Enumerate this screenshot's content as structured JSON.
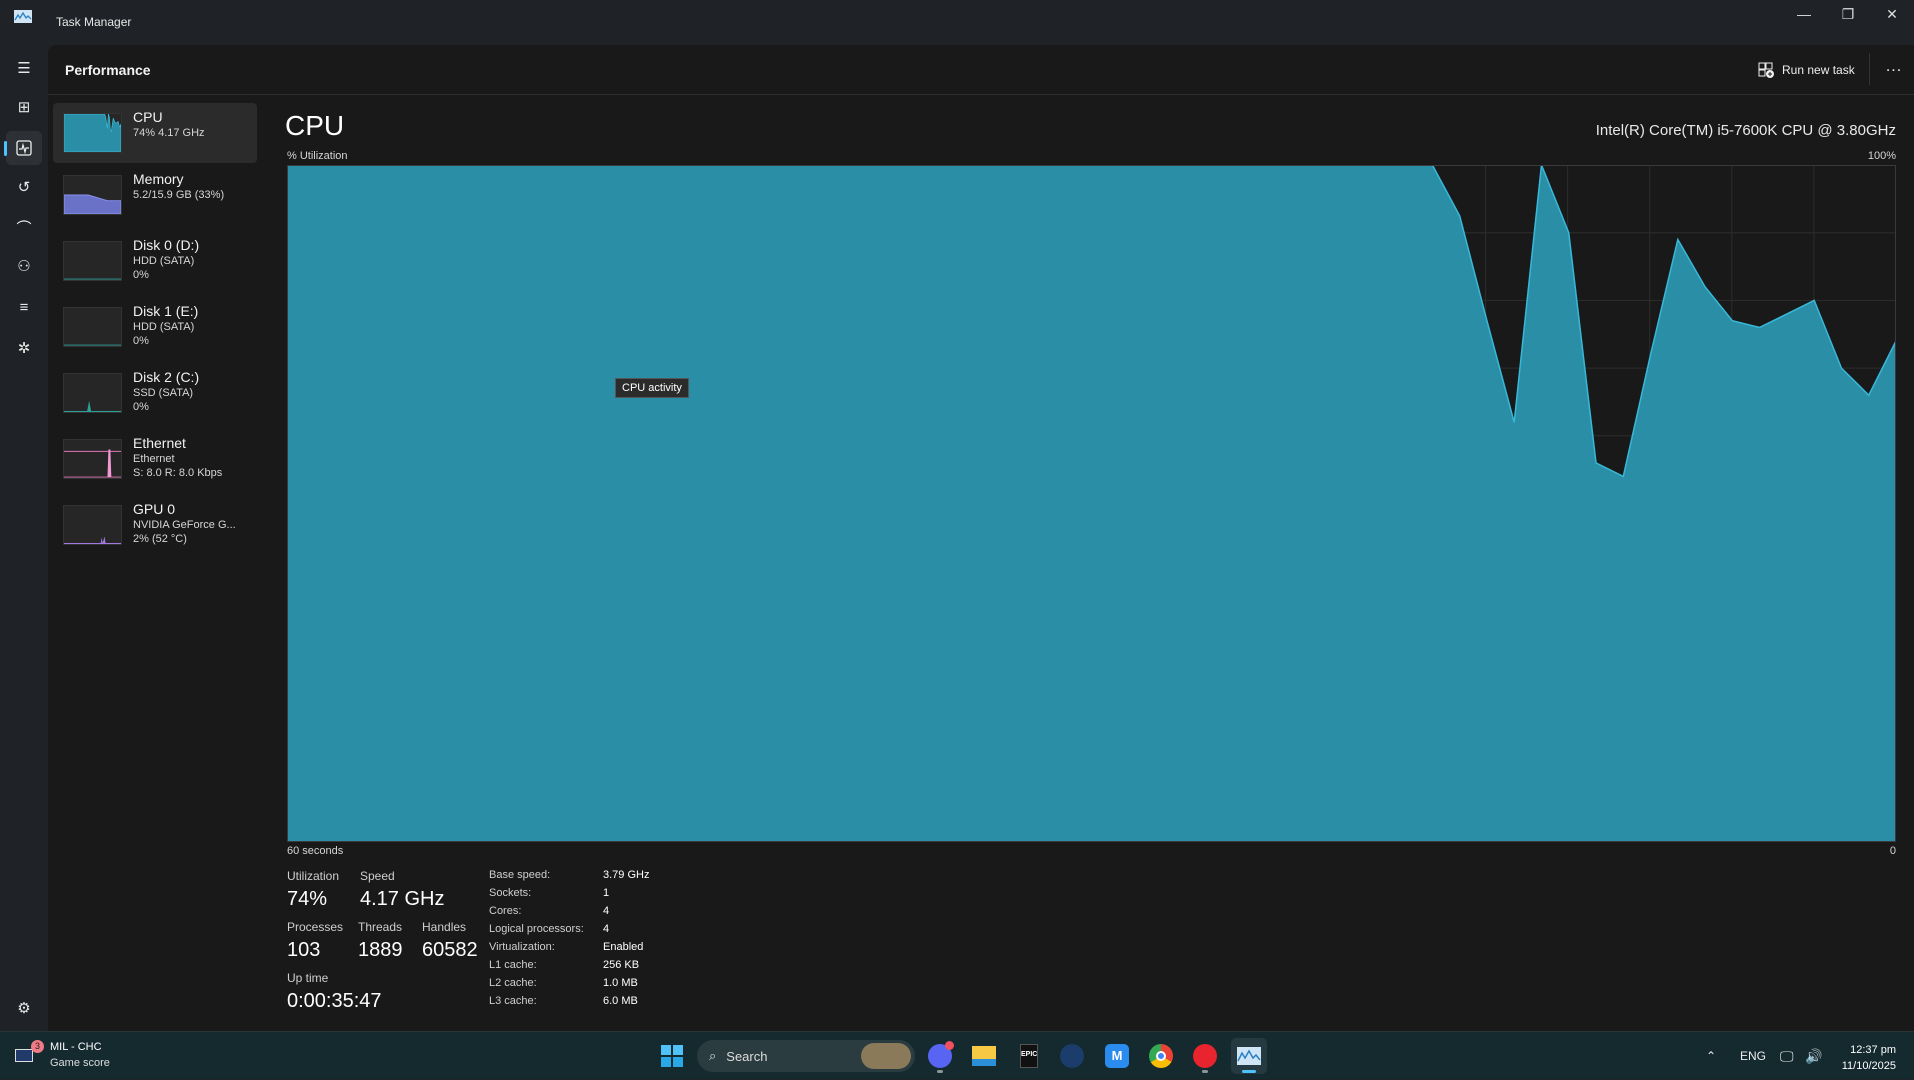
{
  "window": {
    "title": "Task Manager",
    "app_icon": "task-manager-icon",
    "controls": [
      "minimize-icon",
      "restore-icon",
      "close-icon"
    ]
  },
  "nav": {
    "items": [
      "hamburger-menu-icon",
      "processes-icon",
      "performance-icon",
      "app-history-icon",
      "startup-apps-icon",
      "users-icon",
      "details-icon",
      "services-icon"
    ],
    "selected": "performance-icon",
    "settings": "gear-icon"
  },
  "header": {
    "title": "Performance",
    "run_new_task": "Run new task",
    "more": "..."
  },
  "sidebar": {
    "items": [
      {
        "name": "CPU",
        "line1": "74% 4.17 GHz",
        "line2": ""
      },
      {
        "name": "Memory",
        "line1": "5.2/15.9 GB (33%)",
        "line2": ""
      },
      {
        "name": "Disk 0 (D:)",
        "line1": "HDD (SATA)",
        "line2": "0%"
      },
      {
        "name": "Disk 1 (E:)",
        "line1": "HDD (SATA)",
        "line2": "0%"
      },
      {
        "name": "Disk 2 (C:)",
        "line1": "SSD (SATA)",
        "line2": "0%"
      },
      {
        "name": "Ethernet",
        "line1": "Ethernet",
        "line2": "S: 8.0  R: 8.0 Kbps"
      },
      {
        "name": "GPU 0",
        "line1": "NVIDIA GeForce G...",
        "line2": "2%  (52 °C)"
      }
    ]
  },
  "main": {
    "title": "CPU",
    "model": "Intel(R) Core(TM) i5-7600K CPU @ 3.80GHz",
    "tooltip": "CPU activity",
    "stats": {
      "utilization_label": "Utilization",
      "utilization": "74%",
      "speed_label": "Speed",
      "speed": "4.17 GHz",
      "processes_label": "Processes",
      "processes": "103",
      "threads_label": "Threads",
      "threads": "1889",
      "handles_label": "Handles",
      "handles": "60582",
      "uptime_label": "Up time",
      "uptime": "0:00:35:47"
    },
    "specs": [
      {
        "label": "Base speed:",
        "value": "3.79 GHz"
      },
      {
        "label": "Sockets:",
        "value": "1"
      },
      {
        "label": "Cores:",
        "value": "4"
      },
      {
        "label": "Logical processors:",
        "value": "4"
      },
      {
        "label": "Virtualization:",
        "value": "Enabled"
      },
      {
        "label": "L1 cache:",
        "value": "256 KB"
      },
      {
        "label": "L2 cache:",
        "value": "1.0 MB"
      },
      {
        "label": "L3 cache:",
        "value": "6.0 MB"
      }
    ]
  },
  "chart_data": {
    "type": "area",
    "ylabel": "% Utilization",
    "y_max_label": "100%",
    "x_start_label": "60 seconds",
    "x_end_label": "0",
    "ylim": [
      0,
      100
    ],
    "grid": true,
    "colors": {
      "fill": "#2a8ea6",
      "line": "#38b8d8",
      "grid": "#2d2d2d"
    },
    "values": [
      100,
      100,
      100,
      100,
      100,
      100,
      100,
      100,
      100,
      100,
      100,
      100,
      100,
      100,
      100,
      100,
      100,
      100,
      100,
      100,
      100,
      100,
      100,
      100,
      100,
      100,
      100,
      100,
      100,
      100,
      100,
      100,
      100,
      100,
      100,
      100,
      100,
      100,
      100,
      100,
      100,
      100,
      100,
      92.5,
      77,
      62,
      100,
      90,
      56,
      54,
      72,
      89,
      82,
      77,
      76,
      78,
      80,
      70,
      66,
      74
    ]
  },
  "taskbar": {
    "widget": {
      "title": "MIL - CHC",
      "subtitle": "Game score",
      "badge": "3"
    },
    "search_placeholder": "Search",
    "apps": [
      "discord-icon",
      "file-explorer-icon",
      "epic-games-icon",
      "steam-icon",
      "monday-icon",
      "chrome-icon",
      "riot-client-icon",
      "task-manager-icon"
    ],
    "tray": {
      "language": "ENG",
      "time": "12:37 pm",
      "date": "11/10/2025"
    }
  }
}
